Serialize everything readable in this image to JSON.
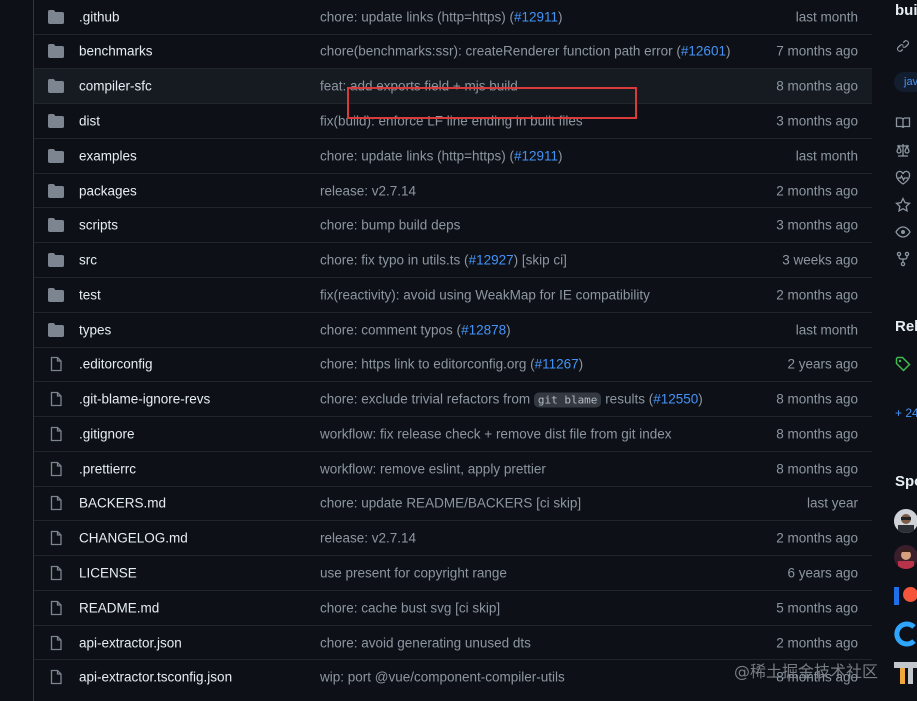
{
  "files": [
    {
      "type": "folder",
      "name": ".github",
      "message": "chore: update links (http=https) (",
      "pr": "#12911",
      "message_after": ")",
      "age": "last month"
    },
    {
      "type": "folder",
      "name": "benchmarks",
      "message": "chore(benchmarks:ssr): createRenderer function path error (",
      "pr": "#12601",
      "message_after": ")",
      "age": "7 months ago"
    },
    {
      "type": "folder",
      "name": "compiler-sfc",
      "message": "feat: add exports field + mjs build",
      "pr": "",
      "message_after": "",
      "age": "8 months ago"
    },
    {
      "type": "folder",
      "name": "dist",
      "message": "fix(build): enforce LF line ending in built files",
      "pr": "",
      "message_after": "",
      "age": "3 months ago"
    },
    {
      "type": "folder",
      "name": "examples",
      "message": "chore: update links (http=https) (",
      "pr": "#12911",
      "message_after": ")",
      "age": "last month"
    },
    {
      "type": "folder",
      "name": "packages",
      "message": "release: v2.7.14",
      "pr": "",
      "message_after": "",
      "age": "2 months ago"
    },
    {
      "type": "folder",
      "name": "scripts",
      "message": "chore: bump build deps",
      "pr": "",
      "message_after": "",
      "age": "3 months ago"
    },
    {
      "type": "folder",
      "name": "src",
      "message": "chore: fix typo in utils.ts (",
      "pr": "#12927",
      "message_after": ") [skip ci]",
      "age": "3 weeks ago"
    },
    {
      "type": "folder",
      "name": "test",
      "message": "fix(reactivity): avoid using WeakMap for IE compatibility",
      "pr": "",
      "message_after": "",
      "age": "2 months ago"
    },
    {
      "type": "folder",
      "name": "types",
      "message": "chore: comment typos (",
      "pr": "#12878",
      "message_after": ")",
      "age": "last month"
    },
    {
      "type": "file",
      "name": ".editorconfig",
      "message": "chore: https link to editorconfig.org (",
      "pr": "#11267",
      "message_after": ")",
      "age": "2 years ago"
    },
    {
      "type": "file",
      "name": ".git-blame-ignore-revs",
      "message": "chore: exclude trivial refactors from ",
      "code": "git blame",
      "message_mid": " results (",
      "pr": "#12550",
      "message_after": ")",
      "age": "8 months ago"
    },
    {
      "type": "file",
      "name": ".gitignore",
      "message": "workflow: fix release check + remove dist file from git index",
      "pr": "",
      "message_after": "",
      "age": "8 months ago"
    },
    {
      "type": "file",
      "name": ".prettierrc",
      "message": "workflow: remove eslint, apply prettier",
      "pr": "",
      "message_after": "",
      "age": "8 months ago"
    },
    {
      "type": "file",
      "name": "BACKERS.md",
      "message": "chore: update README/BACKERS [ci skip]",
      "pr": "",
      "message_after": "",
      "age": "last year"
    },
    {
      "type": "file",
      "name": "CHANGELOG.md",
      "message": "release: v2.7.14",
      "pr": "",
      "message_after": "",
      "age": "2 months ago"
    },
    {
      "type": "file",
      "name": "LICENSE",
      "message": "use present for copyright range",
      "pr": "",
      "message_after": "",
      "age": "6 years ago"
    },
    {
      "type": "file",
      "name": "README.md",
      "message": "chore: cache bust svg [ci skip]",
      "pr": "",
      "message_after": "",
      "age": "5 months ago"
    },
    {
      "type": "file",
      "name": "api-extractor.json",
      "message": "chore: avoid generating unused dts",
      "pr": "",
      "message_after": "",
      "age": "2 months ago"
    },
    {
      "type": "file",
      "name": "api-extractor.tsconfig.json",
      "message": "wip: port @vue/component-compiler-utils",
      "pr": "",
      "message_after": "",
      "age": "8 months ago"
    }
  ],
  "highlighted_row": 3,
  "sidebar": {
    "heading_partial": "bui",
    "topic_partial": "jav",
    "releases_partial": "Rel",
    "more_link": "+ 24",
    "sponsors_partial": "Spo"
  },
  "watermark": "@稀土掘金技术社区",
  "colors": {
    "background": "#0d1117",
    "text": "#e6edf3",
    "muted": "#8d96a0",
    "link": "#4493f8",
    "folder_icon": "#7d8590",
    "annotation": "#d93a3a"
  }
}
